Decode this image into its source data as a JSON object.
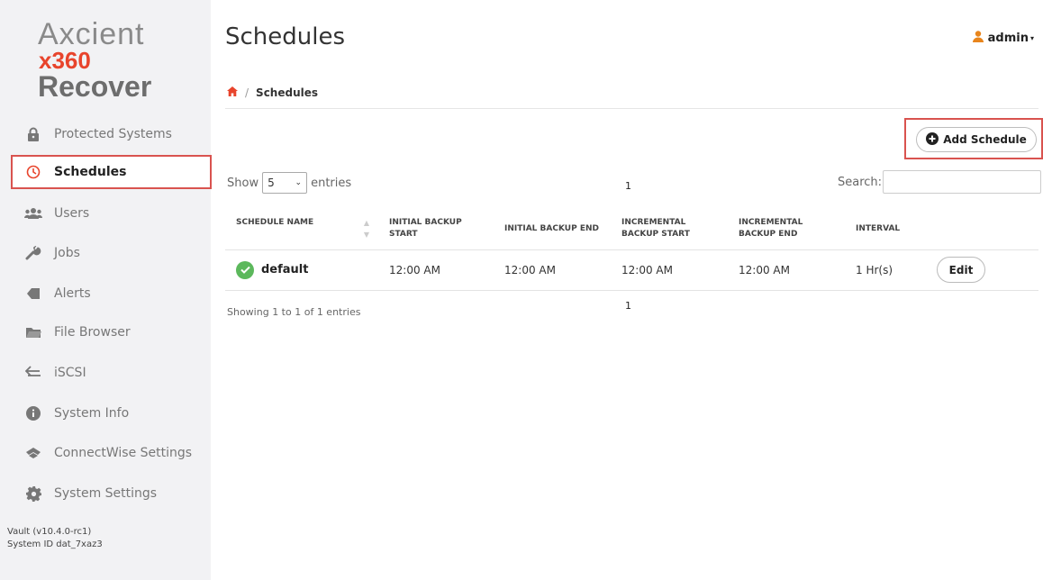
{
  "brand": {
    "line1": "Axcient",
    "line2": "x360",
    "line3": "Recover",
    "accent_color": "#e8442c"
  },
  "sidebar": {
    "items": [
      {
        "label": "Protected Systems",
        "icon": "lock-icon"
      },
      {
        "label": "Schedules",
        "icon": "clock-icon",
        "active": true
      },
      {
        "label": "Users",
        "icon": "users-icon"
      },
      {
        "label": "Jobs",
        "icon": "wrench-icon"
      },
      {
        "label": "Alerts",
        "icon": "tag-icon"
      },
      {
        "label": "File Browser",
        "icon": "folder-icon"
      },
      {
        "label": "iSCSI",
        "icon": "arrows-icon"
      },
      {
        "label": "System Info",
        "icon": "info-icon"
      },
      {
        "label": "ConnectWise Settings",
        "icon": "connectwise-icon"
      },
      {
        "label": "System Settings",
        "icon": "gear-icon"
      }
    ],
    "version": "Vault (v10.4.0-rc1)",
    "system_id": "System ID dat_7xaz3"
  },
  "header": {
    "title": "Schedules",
    "user": "admin"
  },
  "breadcrumb": {
    "current": "Schedules"
  },
  "toolbar": {
    "add_label": "Add Schedule"
  },
  "table_controls": {
    "show_label": "Show",
    "entries_value": "5",
    "entries_label": "entries",
    "search_label": "Search:",
    "search_value": "",
    "page_top": "1",
    "page_bottom": "1",
    "showing": "Showing 1 to 1 of 1 entries"
  },
  "table": {
    "headers": {
      "name": "SCHEDULE NAME",
      "initial_start": "INITIAL BACKUP START",
      "initial_end": "INITIAL BACKUP END",
      "inc_start": "INCREMENTAL BACKUP START",
      "inc_end": "INCREMENTAL BACKUP END",
      "interval": "INTERVAL"
    },
    "rows": [
      {
        "name": "default",
        "status": "ok",
        "initial_start": "12:00 AM",
        "initial_end": "12:00 AM",
        "inc_start": "12:00 AM",
        "inc_end": "12:00 AM",
        "interval": "1 Hr(s)",
        "action": "Edit"
      }
    ]
  }
}
